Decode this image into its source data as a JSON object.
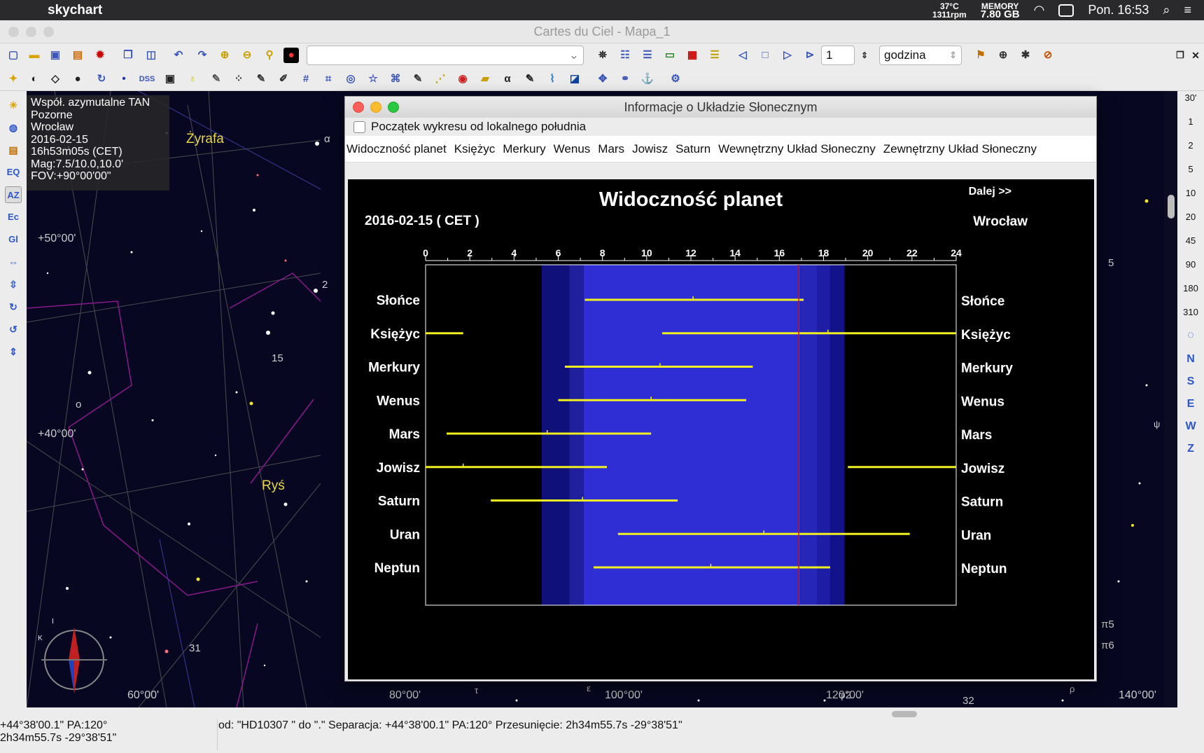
{
  "menubar": {
    "app_name": "skychart",
    "temperature": "37°C",
    "fan_rpm": "1311rpm",
    "memory_label": "MEMORY",
    "memory_value": "7.80 GB",
    "clock": "Pon. 16:53"
  },
  "window": {
    "title": "Cartes du Ciel - Mapa_1"
  },
  "toolbar": {
    "search_value": "",
    "step_value": "1",
    "step_unit": "godzina"
  },
  "infobox": {
    "lines": [
      "Współ. azymutalne TAN",
      "Pozorne",
      "Wrocław",
      "2016-02-15",
      "16h53m05s (CET)",
      "Mag:7.5/10.0,10.0'",
      "FOV:+90°00'00\""
    ]
  },
  "sky": {
    "constellations": [
      "Żyrafa",
      "Ryś"
    ],
    "dec_labels": [
      "+50°00'",
      "+40°00'"
    ],
    "az_labels": [
      "60°00'",
      "80°00'",
      "100°00'",
      "120°00'",
      "140°00'"
    ],
    "star_labels": [
      "α",
      "2",
      "15",
      "o",
      "31",
      "5",
      "π5",
      "π6",
      "φ2",
      "32",
      "ι",
      "κ",
      "τ",
      "ε",
      "ρ",
      "ψ"
    ]
  },
  "right_toolbar": {
    "fov_items": [
      "30'",
      "1",
      "2",
      "5",
      "10",
      "20",
      "45",
      "90",
      "180",
      "310"
    ],
    "dir_items": [
      "N",
      "S",
      "E",
      "W",
      "Z"
    ]
  },
  "dialog": {
    "title": "Informacje o Układzie Słonecznym",
    "checkbox_label": "Początek wykresu od lokalnego południa",
    "tabs": [
      "Widoczność planet",
      "Księżyc",
      "Merkury",
      "Wenus",
      "Mars",
      "Jowisz",
      "Saturn",
      "Wewnętrzny Układ Słoneczny",
      "Zewnętrzny Układ Słoneczny"
    ],
    "plot": {
      "next_label": "Dalej >>",
      "date_label": "2016-02-15   ( CET )",
      "location": "Wrocław"
    }
  },
  "chart_data": {
    "type": "gantt",
    "title": "Widoczność planet",
    "x_ticks": [
      0,
      2,
      4,
      6,
      8,
      10,
      12,
      14,
      16,
      18,
      20,
      22,
      24
    ],
    "xlim": [
      0,
      24
    ],
    "current_time": 16.88,
    "twilight_bands": [
      {
        "from": 5.25,
        "to": 6.5,
        "color": "#10107a"
      },
      {
        "from": 6.5,
        "to": 7.15,
        "color": "#20209e"
      },
      {
        "from": 7.15,
        "to": 16.95,
        "color": "#2e2ed4"
      },
      {
        "from": 16.95,
        "to": 17.7,
        "color": "#2626b8"
      },
      {
        "from": 17.7,
        "to": 18.3,
        "color": "#1d1da6"
      },
      {
        "from": 18.3,
        "to": 18.95,
        "color": "#12128a"
      }
    ],
    "series": [
      {
        "name": "Słońce",
        "segments": [
          [
            7.2,
            17.1
          ]
        ],
        "transit": 12.1
      },
      {
        "name": "Księżyc",
        "segments": [
          [
            0,
            1.7
          ],
          [
            10.7,
            24
          ]
        ],
        "transit": 18.2
      },
      {
        "name": "Merkury",
        "segments": [
          [
            6.3,
            14.8
          ]
        ],
        "transit": 10.6
      },
      {
        "name": "Wenus",
        "segments": [
          [
            6.0,
            14.5
          ]
        ],
        "transit": 10.2
      },
      {
        "name": "Mars",
        "segments": [
          [
            0.95,
            10.2
          ]
        ],
        "transit": 5.5
      },
      {
        "name": "Jowisz",
        "segments": [
          [
            0,
            8.2
          ],
          [
            19.1,
            24
          ]
        ],
        "transit": 1.7
      },
      {
        "name": "Saturn",
        "segments": [
          [
            2.95,
            11.4
          ]
        ],
        "transit": 7.1
      },
      {
        "name": "Uran",
        "segments": [
          [
            8.7,
            21.9
          ]
        ],
        "transit": 15.3
      },
      {
        "name": "Neptun",
        "segments": [
          [
            7.6,
            18.3
          ]
        ],
        "transit": 12.9
      }
    ],
    "bar_color": "#f0f020",
    "now_line_color": "#d01010"
  },
  "status": {
    "line1": "+44°38'00.1\" PA:120°",
    "line2": "2h34m55.7s -29°38'51\"",
    "message": "od:  \"HD10307 \" do \".\" Separacja: +44°38'00.1\" PA:120° Przesunięcie:  2h34m55.7s -29°38'51\""
  }
}
